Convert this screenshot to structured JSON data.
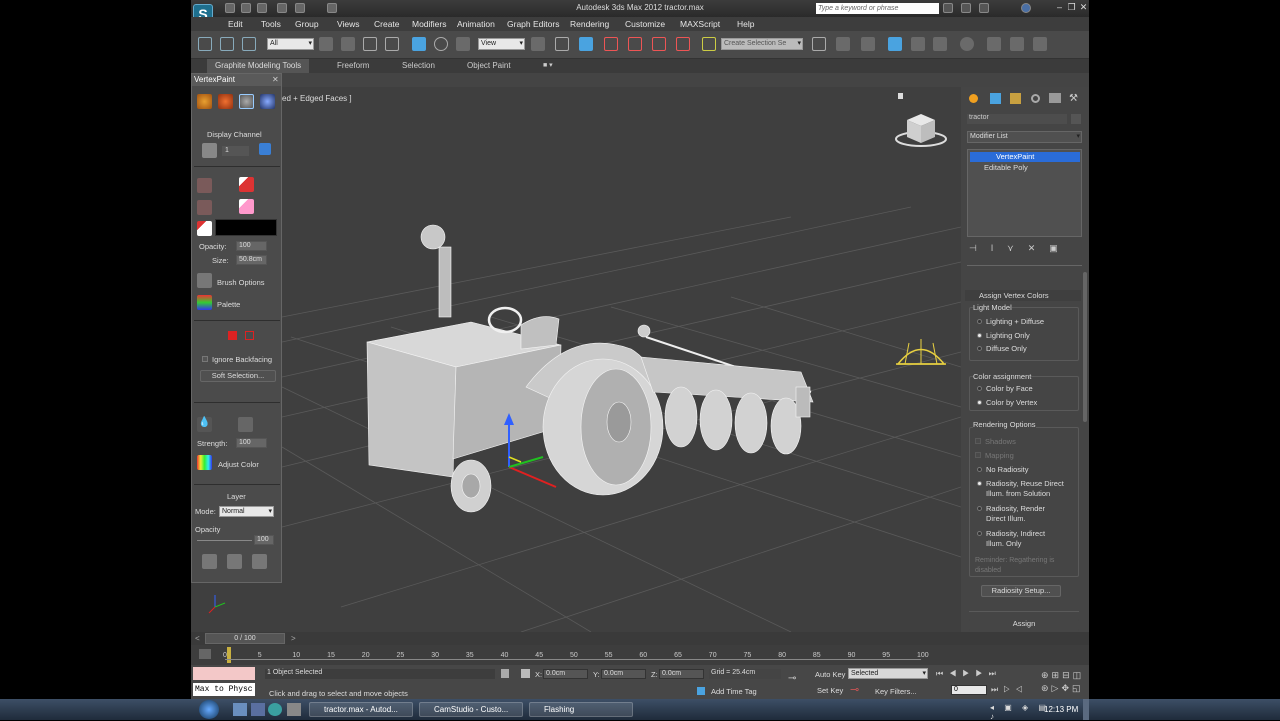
{
  "window": {
    "title": "Autodesk 3ds Max 2012        tractor.max",
    "search_placeholder": "Type a keyword or phrase",
    "logo": "S"
  },
  "menu": [
    "Edit",
    "Tools",
    "Group",
    "Views",
    "Create",
    "Modifiers",
    "Animation",
    "Graph Editors",
    "Rendering",
    "Customize",
    "MAXScript",
    "Help"
  ],
  "toolbar": {
    "selection_filter": "All",
    "ref_coord": "View",
    "named_selection": "Create Selection Se"
  },
  "ribbon": {
    "tabs": [
      "Graphite Modeling Tools",
      "Freeform",
      "Selection",
      "Object Paint"
    ]
  },
  "vertexpaint": {
    "title": "VertexPaint",
    "display_channel": "Display Channel",
    "channel_value": "1",
    "opacity_label": "Opacity:",
    "opacity_value": "100",
    "size_label": "Size:",
    "size_value": "50.8cm",
    "brush_options": "Brush Options",
    "palette": "Palette",
    "ignore_backfacing": "Ignore Backfacing",
    "soft_selection": "Soft Selection...",
    "strength_label": "Strength:",
    "strength_value": "100",
    "adjust_color": "Adjust Color",
    "layer": "Layer",
    "mode_label": "Mode:",
    "mode_value": "Normal",
    "layer_opacity_label": "Opacity",
    "layer_opacity_value": "100",
    "paint_color": "#000000"
  },
  "viewport": {
    "label": "ed + Edged Faces ]"
  },
  "cmdpanel": {
    "object_name": "tractor",
    "modifier_list": "Modifier List",
    "stack": [
      "VertexPaint",
      "Editable Poly"
    ],
    "rollout_title": "Assign Vertex Colors",
    "light_model": "Light Model",
    "light_opts": [
      "Lighting + Diffuse",
      "Lighting Only",
      "Diffuse Only"
    ],
    "color_assignment": "Color assignment",
    "color_opts": [
      "Color by Face",
      "Color by Vertex"
    ],
    "rendering_options": "Rendering Options",
    "shadows": "Shadows",
    "mapping": "Mapping",
    "no_radiosity": "No Radiosity",
    "rad1": "Radiosity, Reuse Direct Illum. from Solution",
    "rad2": "Radiosity, Render Direct Illum.",
    "rad3": "Radiosity, Indirect Illum. Only",
    "reminder": "Reminder: Regathering is disabled",
    "radiosity_setup": "Radiosity Setup...",
    "assign": "Assign"
  },
  "timeline": {
    "frame": "0 / 100",
    "ticks": [
      "0",
      "5",
      "10",
      "15",
      "20",
      "25",
      "30",
      "35",
      "40",
      "45",
      "50",
      "55",
      "60",
      "65",
      "70",
      "75",
      "80",
      "85",
      "90",
      "95",
      "100"
    ]
  },
  "status": {
    "maxscript": "Max to Physc",
    "selected": "1 Object Selected",
    "prompt": "Click and drag to select and move objects",
    "x_label": "X:",
    "x_value": "0.0cm",
    "y_label": "Y:",
    "y_value": "0.0cm",
    "z_label": "Z:",
    "z_value": "0.0cm",
    "grid": "Grid = 25.4cm",
    "add_time_tag": "Add Time Tag",
    "auto_key": "Auto Key",
    "set_key": "Set Key",
    "key_mode": "Selected",
    "key_filters": "Key Filters...",
    "current_frame": "0"
  },
  "taskbar": {
    "items": [
      "tractor.max - Autod...",
      "CamStudio - Custo...",
      "Flashing"
    ],
    "clock": "12:13 PM"
  }
}
